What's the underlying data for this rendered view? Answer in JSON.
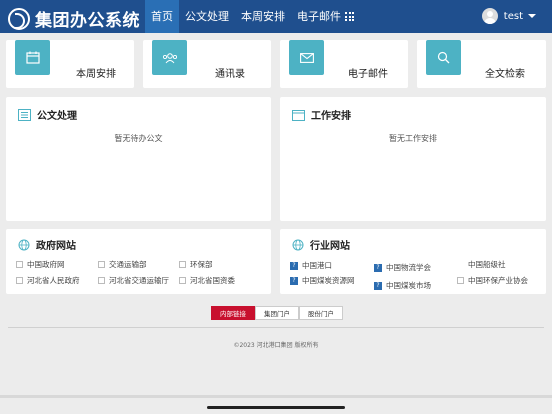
{
  "app": {
    "logo_text": "集团办公系统",
    "user_name": "test"
  },
  "nav": {
    "items": [
      {
        "label": "首页",
        "active": true
      },
      {
        "label": "公文处理",
        "active": false
      },
      {
        "label": "本周安排",
        "active": false
      },
      {
        "label": "电子邮件",
        "active": false
      }
    ]
  },
  "quick_links": [
    {
      "label": "本周安排",
      "icon": "calendar-icon"
    },
    {
      "label": "通讯录",
      "icon": "contacts-icon"
    },
    {
      "label": "电子邮件",
      "icon": "mail-icon"
    },
    {
      "label": "全文检索",
      "icon": "search-icon"
    }
  ],
  "panels": {
    "documents": {
      "title": "公文处理",
      "empty_text": "暂无待办公文"
    },
    "work": {
      "title": "工作安排",
      "empty_text": "暂无工作安排"
    }
  },
  "gov_sites": {
    "title": "政府网站",
    "links": [
      "中国政府网",
      "交通运输部",
      "环保部",
      "河北省人民政府",
      "河北省交通运输厅",
      "河北省国资委"
    ]
  },
  "industry_sites": {
    "title": "行业网站",
    "links": [
      "中国港口",
      "中国物流学会",
      "中国船级社",
      "中国煤炭资源网",
      "中国煤炭市场",
      "中国环保产业协会"
    ]
  },
  "footer": {
    "tabs": [
      "内部链接",
      "集团门户",
      "股份门户"
    ],
    "copyright": "©2023 河北港口集团 版权所有"
  },
  "colors": {
    "topbar": "#1f4f8e",
    "accent": "#4db2c4",
    "active_tab": "#c8102e"
  }
}
